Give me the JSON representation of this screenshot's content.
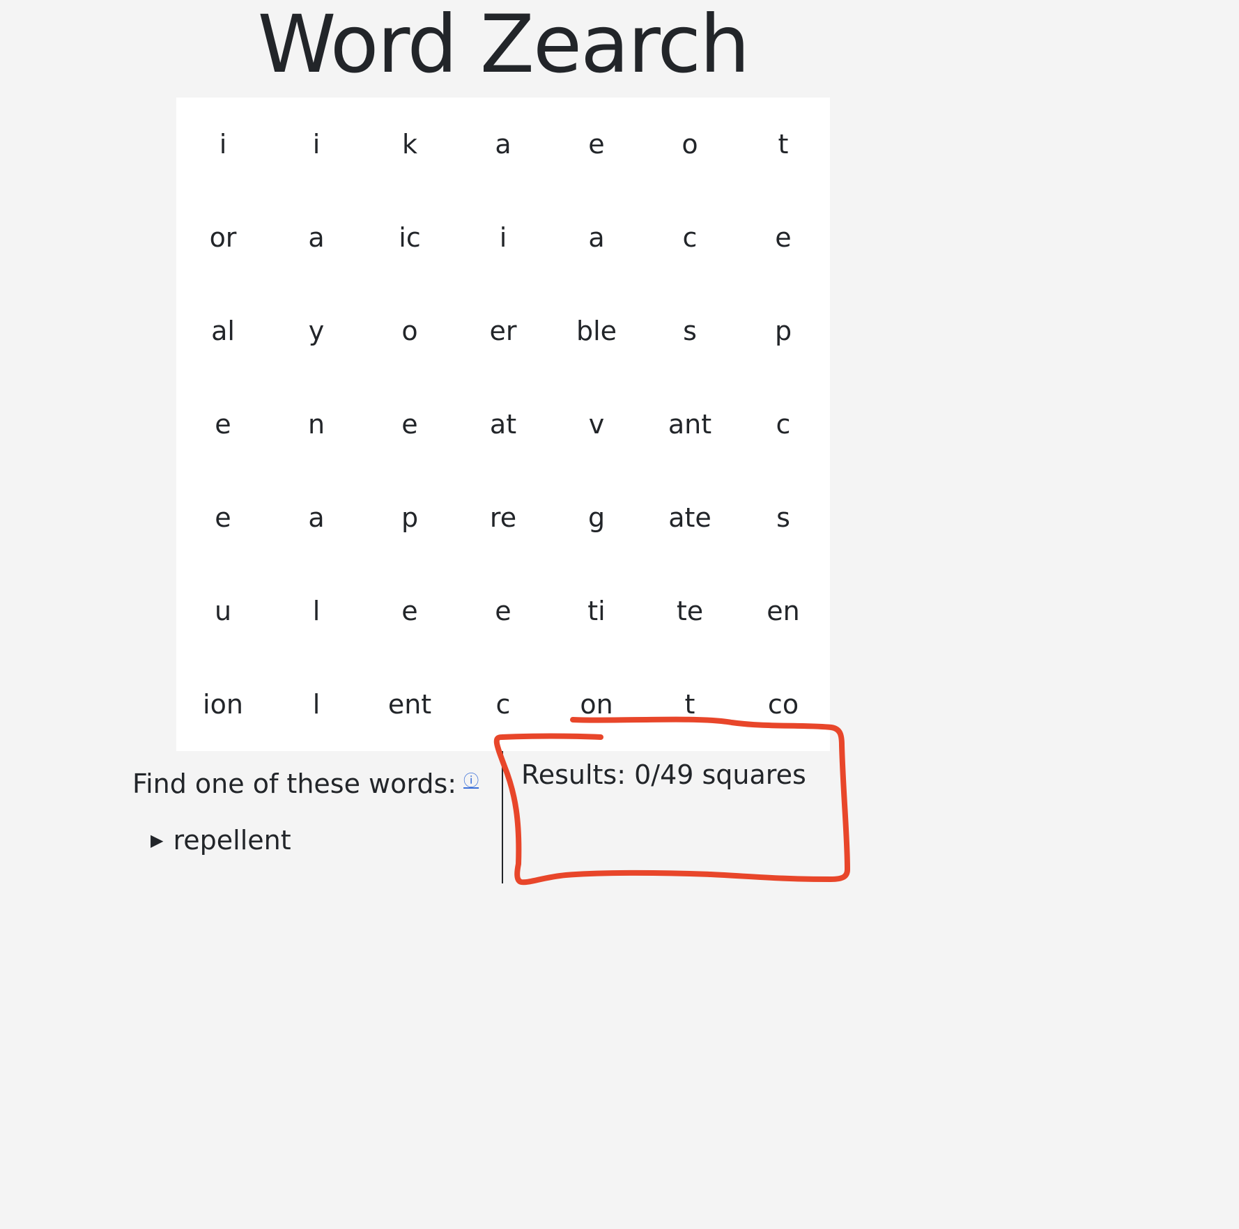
{
  "app": {
    "title": "Word Zearch"
  },
  "grid": {
    "rows": [
      [
        "i",
        "i",
        "k",
        "a",
        "e",
        "o",
        "t"
      ],
      [
        "or",
        "a",
        "ic",
        "i",
        "a",
        "c",
        "e"
      ],
      [
        "al",
        "y",
        "o",
        "er",
        "ble",
        "s",
        "p"
      ],
      [
        "e",
        "n",
        "e",
        "at",
        "v",
        "ant",
        "c"
      ],
      [
        "e",
        "a",
        "p",
        "re",
        "g",
        "ate",
        "s"
      ],
      [
        "u",
        "l",
        "e",
        "e",
        "ti",
        "te",
        "en"
      ],
      [
        "ion",
        "l",
        "ent",
        "c",
        "on",
        "t",
        "co"
      ]
    ]
  },
  "words": {
    "label": "Find one of these words:",
    "info_icon": "ⓘ",
    "items": [
      {
        "arrow": "▶",
        "label": "repellent"
      }
    ]
  },
  "results": {
    "text": "Results: 0/49 squares"
  },
  "colors": {
    "background": "#f4f4f4",
    "grid_background": "#ffffff",
    "text": "#222529",
    "link": "#3a6fd8",
    "annotation_stroke": "#e8462a"
  }
}
